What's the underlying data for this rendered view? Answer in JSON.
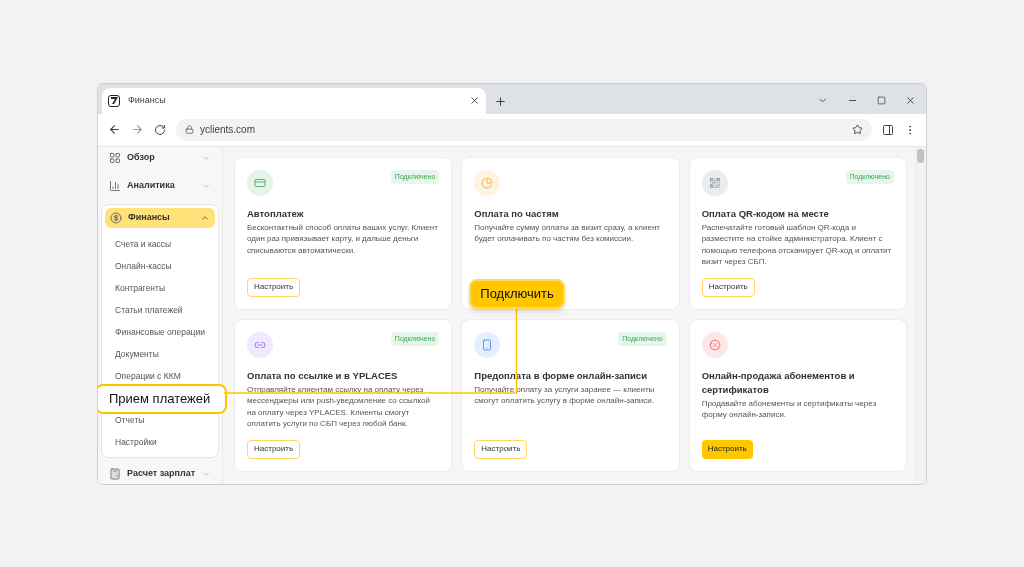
{
  "browser": {
    "tab_title": "Финансы",
    "url": "yclients.com"
  },
  "sidebar": {
    "groups": [
      {
        "label": "Обзор",
        "expanded": false,
        "selected": false
      },
      {
        "label": "Аналитика",
        "expanded": false,
        "selected": false
      },
      {
        "label": "Финансы",
        "expanded": true,
        "selected": true,
        "children": [
          {
            "label": "Счета и кассы",
            "highlighted": false
          },
          {
            "label": "Онлайн-кассы",
            "highlighted": false
          },
          {
            "label": "Контрагенты",
            "highlighted": false
          },
          {
            "label": "Статьи платежей",
            "highlighted": false
          },
          {
            "label": "Финансовые операции",
            "highlighted": false
          },
          {
            "label": "Документы",
            "highlighted": false
          },
          {
            "label": "Операции с ККМ",
            "highlighted": false
          },
          {
            "label": "Прием платежей",
            "highlighted": true
          },
          {
            "label": "Отчеты",
            "highlighted": false
          },
          {
            "label": "Настройки",
            "highlighted": false
          }
        ]
      },
      {
        "label": "Расчет зарплат",
        "expanded": false,
        "selected": false
      }
    ]
  },
  "cards": [
    {
      "title": "Автоплатеж",
      "description": "Бесконтактный способ оплаты ваших услуг. Клиент один раз привязывает карту, и дальше деньги списываются автоматически.",
      "badge": "Подключено",
      "button": {
        "label": "Настроить",
        "kind": "outline"
      }
    },
    {
      "title": "Оплата по частям",
      "description": "Получайте сумму оплаты за визит сразу, а клиент будет оплачивать по частям без комиссии.",
      "button": {
        "label": "Подключить",
        "kind": "callout"
      }
    },
    {
      "title": "Оплата QR-кодом на месте",
      "description": "Распечатайте готовый шаблон QR-кода и разместите на стойке администратора. Клиент с помощью телефона отсканирует QR-код и оплатит визит через СБП.",
      "badge": "Подключено",
      "button": {
        "label": "Настроить",
        "kind": "outline"
      }
    },
    {
      "title": "Оплата по ссылке и в YPLACES",
      "description": "Отправляйте клиентам ссылку на оплату через мессенджеры или push-уведомление со ссылкой на оплату через YPLACES. Клиенты смогут оплатить услуги по СБП через любой банк.",
      "badge": "Подключено",
      "button": {
        "label": "Настроить",
        "kind": "outline"
      }
    },
    {
      "title": "Предоплата в форме онлайн-записи",
      "description": "Получайте оплату за услуги заранее — клиенты смогут оплатить услугу в форме онлайн-записи.",
      "badge": "Подключено",
      "button": {
        "label": "Настроить",
        "kind": "outline"
      }
    },
    {
      "title": "Онлайн-продажа абонементов и сертификатов",
      "description": "Продавайте абонементы и сертификаты через форму онлайн-записи.",
      "button": {
        "label": "Настроить",
        "kind": "filled"
      }
    }
  ]
}
